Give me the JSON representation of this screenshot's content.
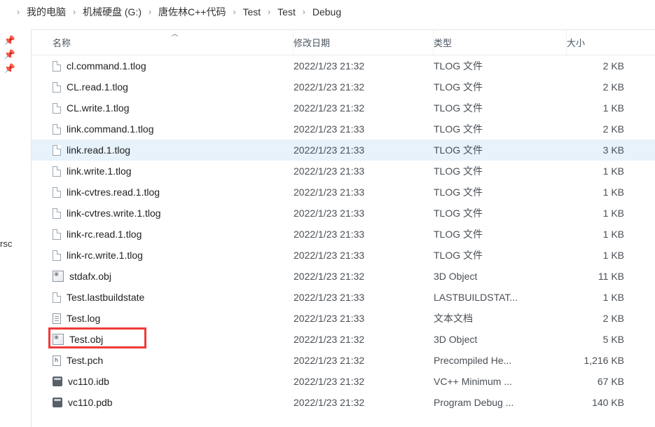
{
  "breadcrumb": [
    "我的电脑",
    "机械硬盘 (G:)",
    "唐佐林C++代码",
    "Test",
    "Test",
    "Debug"
  ],
  "side_text": "rsc",
  "columns": {
    "name": "名称",
    "date": "修改日期",
    "type": "类型",
    "size": "大小"
  },
  "files": [
    {
      "name": "cl.command.1.tlog",
      "date": "2022/1/23 21:32",
      "type": "TLOG 文件",
      "size": "2 KB",
      "icon": "file-doc"
    },
    {
      "name": "CL.read.1.tlog",
      "date": "2022/1/23 21:32",
      "type": "TLOG 文件",
      "size": "2 KB",
      "icon": "file-doc"
    },
    {
      "name": "CL.write.1.tlog",
      "date": "2022/1/23 21:32",
      "type": "TLOG 文件",
      "size": "1 KB",
      "icon": "file-doc"
    },
    {
      "name": "link.command.1.tlog",
      "date": "2022/1/23 21:33",
      "type": "TLOG 文件",
      "size": "2 KB",
      "icon": "file-doc"
    },
    {
      "name": "link.read.1.tlog",
      "date": "2022/1/23 21:33",
      "type": "TLOG 文件",
      "size": "3 KB",
      "icon": "file-doc",
      "selected": true
    },
    {
      "name": "link.write.1.tlog",
      "date": "2022/1/23 21:33",
      "type": "TLOG 文件",
      "size": "1 KB",
      "icon": "file-doc"
    },
    {
      "name": "link-cvtres.read.1.tlog",
      "date": "2022/1/23 21:33",
      "type": "TLOG 文件",
      "size": "1 KB",
      "icon": "file-doc"
    },
    {
      "name": "link-cvtres.write.1.tlog",
      "date": "2022/1/23 21:33",
      "type": "TLOG 文件",
      "size": "1 KB",
      "icon": "file-doc"
    },
    {
      "name": "link-rc.read.1.tlog",
      "date": "2022/1/23 21:33",
      "type": "TLOG 文件",
      "size": "1 KB",
      "icon": "file-doc"
    },
    {
      "name": "link-rc.write.1.tlog",
      "date": "2022/1/23 21:33",
      "type": "TLOG 文件",
      "size": "1 KB",
      "icon": "file-doc"
    },
    {
      "name": "stdafx.obj",
      "date": "2022/1/23 21:32",
      "type": "3D Object",
      "size": "11 KB",
      "icon": "obj-3d"
    },
    {
      "name": "Test.lastbuildstate",
      "date": "2022/1/23 21:33",
      "type": "LASTBUILDSTAT...",
      "size": "1 KB",
      "icon": "file-doc"
    },
    {
      "name": "Test.log",
      "date": "2022/1/23 21:33",
      "type": "文本文档",
      "size": "2 KB",
      "icon": "txt-doc"
    },
    {
      "name": "Test.obj",
      "date": "2022/1/23 21:32",
      "type": "3D Object",
      "size": "5 KB",
      "icon": "obj-3d",
      "highlight": true
    },
    {
      "name": "Test.pch",
      "date": "2022/1/23 21:32",
      "type": "Precompiled He...",
      "size": "1,216 KB",
      "icon": "pch"
    },
    {
      "name": "vc110.idb",
      "date": "2022/1/23 21:32",
      "type": "VC++ Minimum ...",
      "size": "67 KB",
      "icon": "db"
    },
    {
      "name": "vc110.pdb",
      "date": "2022/1/23 21:32",
      "type": "Program Debug ...",
      "size": "140 KB",
      "icon": "db"
    }
  ]
}
